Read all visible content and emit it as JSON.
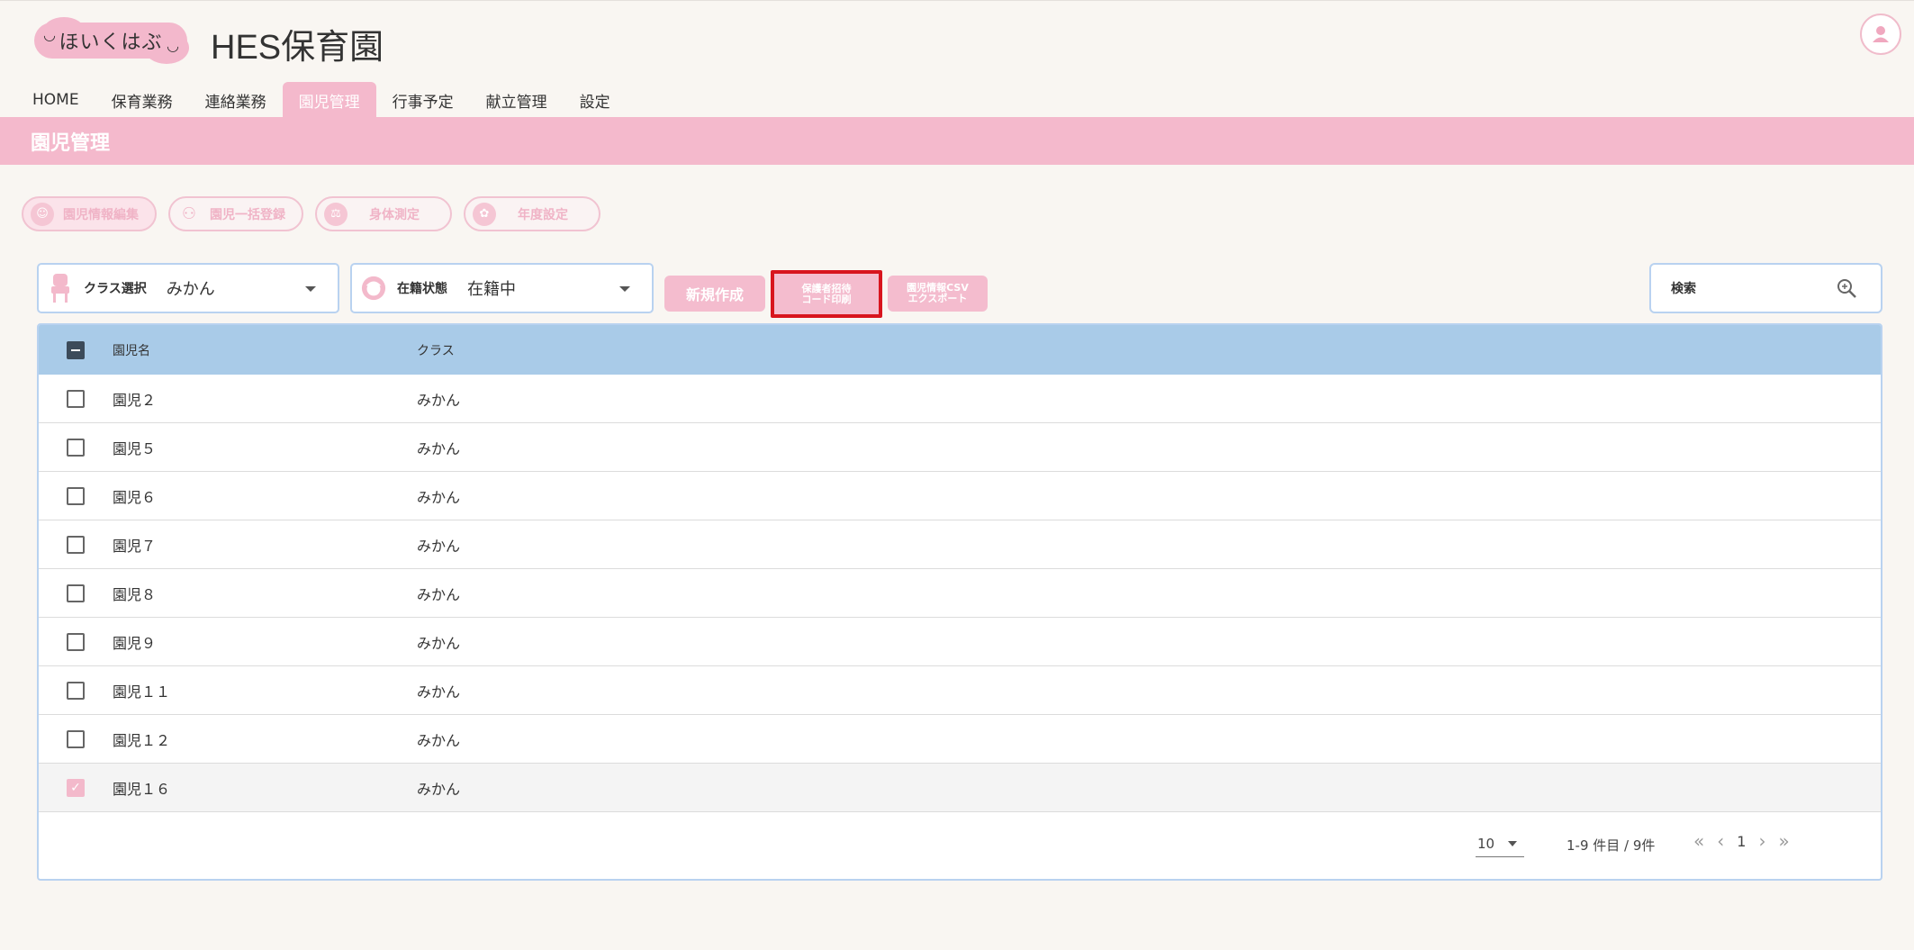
{
  "header": {
    "logo_text": "ほいくはぶ",
    "title": "HES保育園",
    "user_icon": "user-icon"
  },
  "nav": [
    {
      "label": "HOME",
      "active": false
    },
    {
      "label": "保育業務",
      "active": false
    },
    {
      "label": "連絡業務",
      "active": false
    },
    {
      "label": "園児管理",
      "active": true
    },
    {
      "label": "行事予定",
      "active": false
    },
    {
      "label": "献立管理",
      "active": false
    },
    {
      "label": "設定",
      "active": false
    }
  ],
  "page_title": "園児管理",
  "subtools": [
    {
      "label": "園児情報編集",
      "icon": "child-icon"
    },
    {
      "label": "園児一括登録",
      "icon": "group-icon"
    },
    {
      "label": "身体測定",
      "icon": "scale-icon"
    },
    {
      "label": "年度設定",
      "icon": "badge-icon"
    }
  ],
  "filters": {
    "class_label": "クラス選択",
    "class_value": "みかん",
    "status_label": "在籍状態",
    "status_value": "在籍中"
  },
  "actions": {
    "new_label": "新規作成",
    "print_line1": "保護者招待",
    "print_line2": "コード印刷",
    "export_line1": "園児情報CSV",
    "export_line2": "エクスポート"
  },
  "search": {
    "placeholder": "検索"
  },
  "table": {
    "headers": [
      "園児名",
      "クラス"
    ],
    "rows": [
      {
        "name": "園児２",
        "class": "みかん",
        "checked": false
      },
      {
        "name": "園児５",
        "class": "みかん",
        "checked": false
      },
      {
        "name": "園児６",
        "class": "みかん",
        "checked": false
      },
      {
        "name": "園児７",
        "class": "みかん",
        "checked": false
      },
      {
        "name": "園児８",
        "class": "みかん",
        "checked": false
      },
      {
        "name": "園児９",
        "class": "みかん",
        "checked": false
      },
      {
        "name": "園児１１",
        "class": "みかん",
        "checked": false
      },
      {
        "name": "園児１２",
        "class": "みかん",
        "checked": false
      },
      {
        "name": "園児１６",
        "class": "みかん",
        "checked": true
      }
    ]
  },
  "pager": {
    "per_page": "10",
    "range": "1-9 件目 / 9件",
    "page": "1"
  },
  "colors": {
    "accent_pink": "#f4b9cc",
    "header_blue": "#a9cbe8",
    "highlight_red": "#d8151e"
  }
}
